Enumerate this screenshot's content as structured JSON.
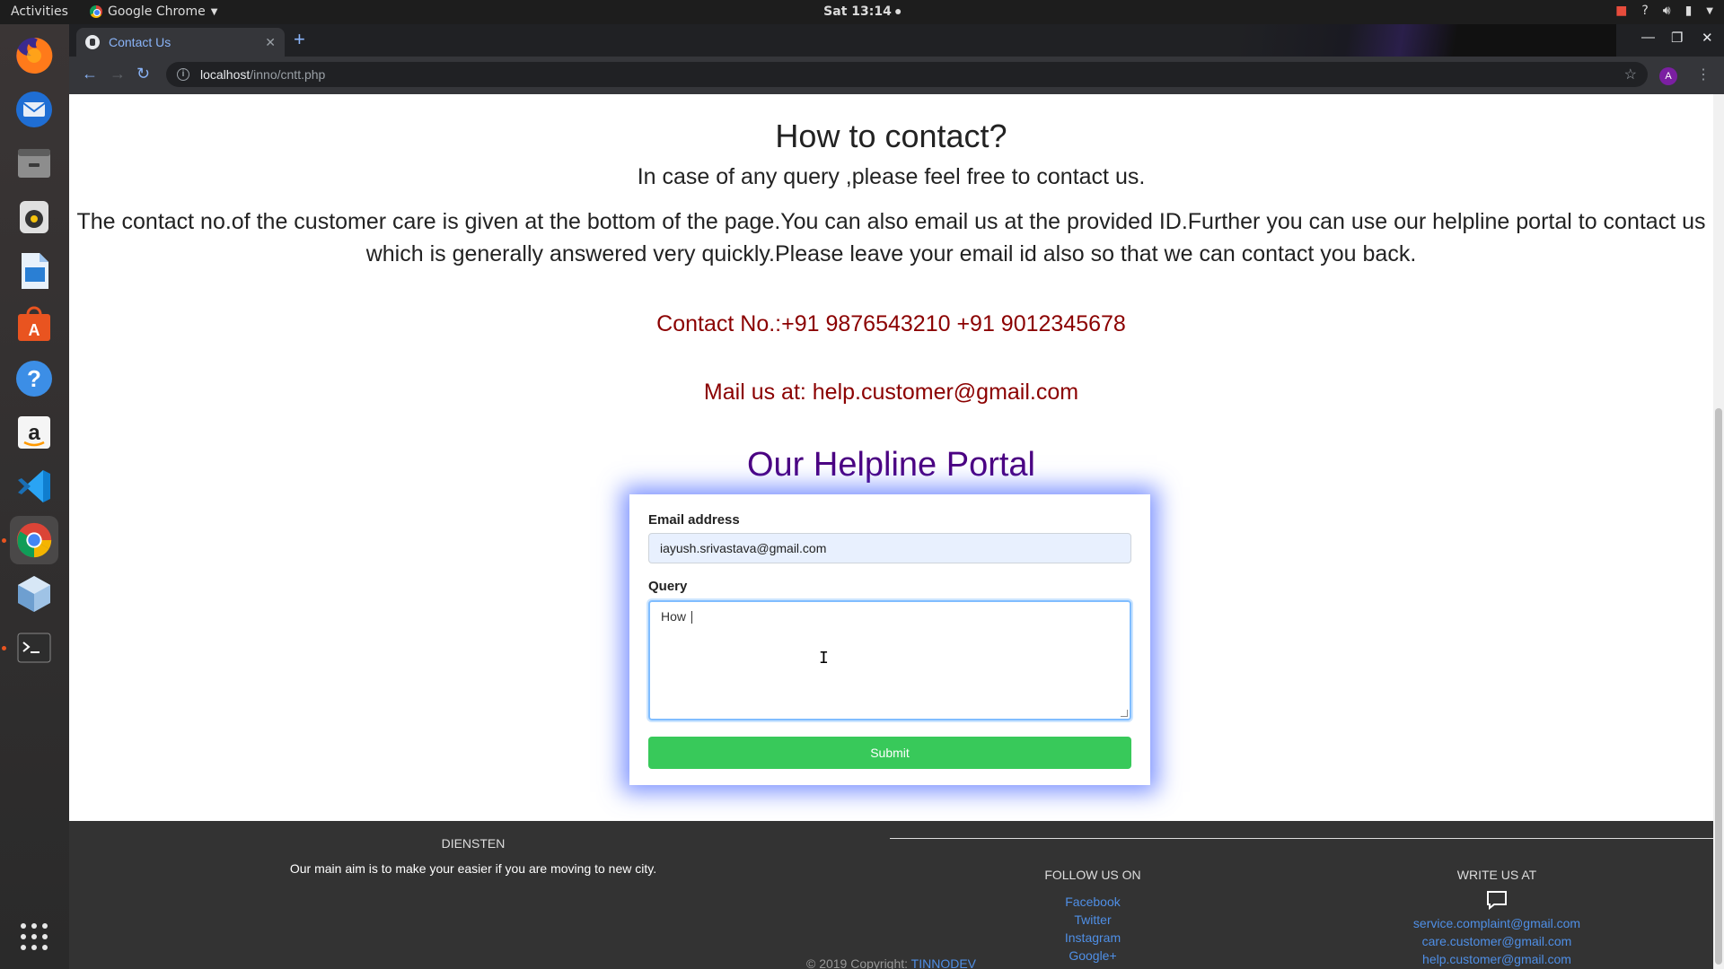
{
  "topbar": {
    "activities": "Activities",
    "app_name": "Google Chrome",
    "clock": "Sat 13:14"
  },
  "browser": {
    "tab_title": "Contact Us",
    "url_host": "localhost",
    "url_path": "/inno/cntt.php",
    "profile_initial": "A"
  },
  "page": {
    "title": "How to contact?",
    "intro": "In case of any query ,please feel free to contact us.",
    "paragraph": "The contact no.of the customer care is given at the bottom of the page.You can also email us at the provided ID.Further you can use our helpline portal to contact us which is generally answered very quickly.Please leave your email id also so that we can contact you back.",
    "contact_line": "Contact No.:+91 9876543210 +91 9012345678",
    "mail_line": "Mail us at: help.customer@gmail.com",
    "portal_title": "Our Helpline Portal"
  },
  "form": {
    "email_label": "Email address",
    "email_value": "iayush.srivastava@gmail.com",
    "query_label": "Query",
    "query_value": "How ",
    "submit_label": "Submit"
  },
  "footer": {
    "dien_heading": "DIENSTEN",
    "aim_text": "Our main aim is to make your easier if you are moving to new city.",
    "follow_heading": "FOLLOW US ON",
    "social_links": [
      "Facebook",
      "Twitter",
      "Instagram",
      "Google+"
    ],
    "write_heading": "WRITE US AT",
    "emails": [
      "service.complaint@gmail.com",
      "care.customer@gmail.com",
      "help.customer@gmail.com"
    ],
    "copyright_prefix": "© 2019 Copyright:",
    "copyright_brand": "TINNODEV"
  },
  "colors": {
    "contact_text": "#8b0000",
    "portal_title": "#4b0082",
    "submit_bg": "#38c95a",
    "footer_bg": "#333333",
    "link": "#4f8fe6",
    "form_glow": "#506eff"
  },
  "dock_icons": [
    "firefox-icon",
    "thunderbird-icon",
    "files-icon",
    "rhythmbox-icon",
    "libreoffice-writer-icon",
    "software-center-icon",
    "help-icon",
    "amazon-icon",
    "vscode-icon",
    "chrome-icon",
    "virtualbox-icon",
    "terminal-icon",
    "show-apps-icon"
  ]
}
